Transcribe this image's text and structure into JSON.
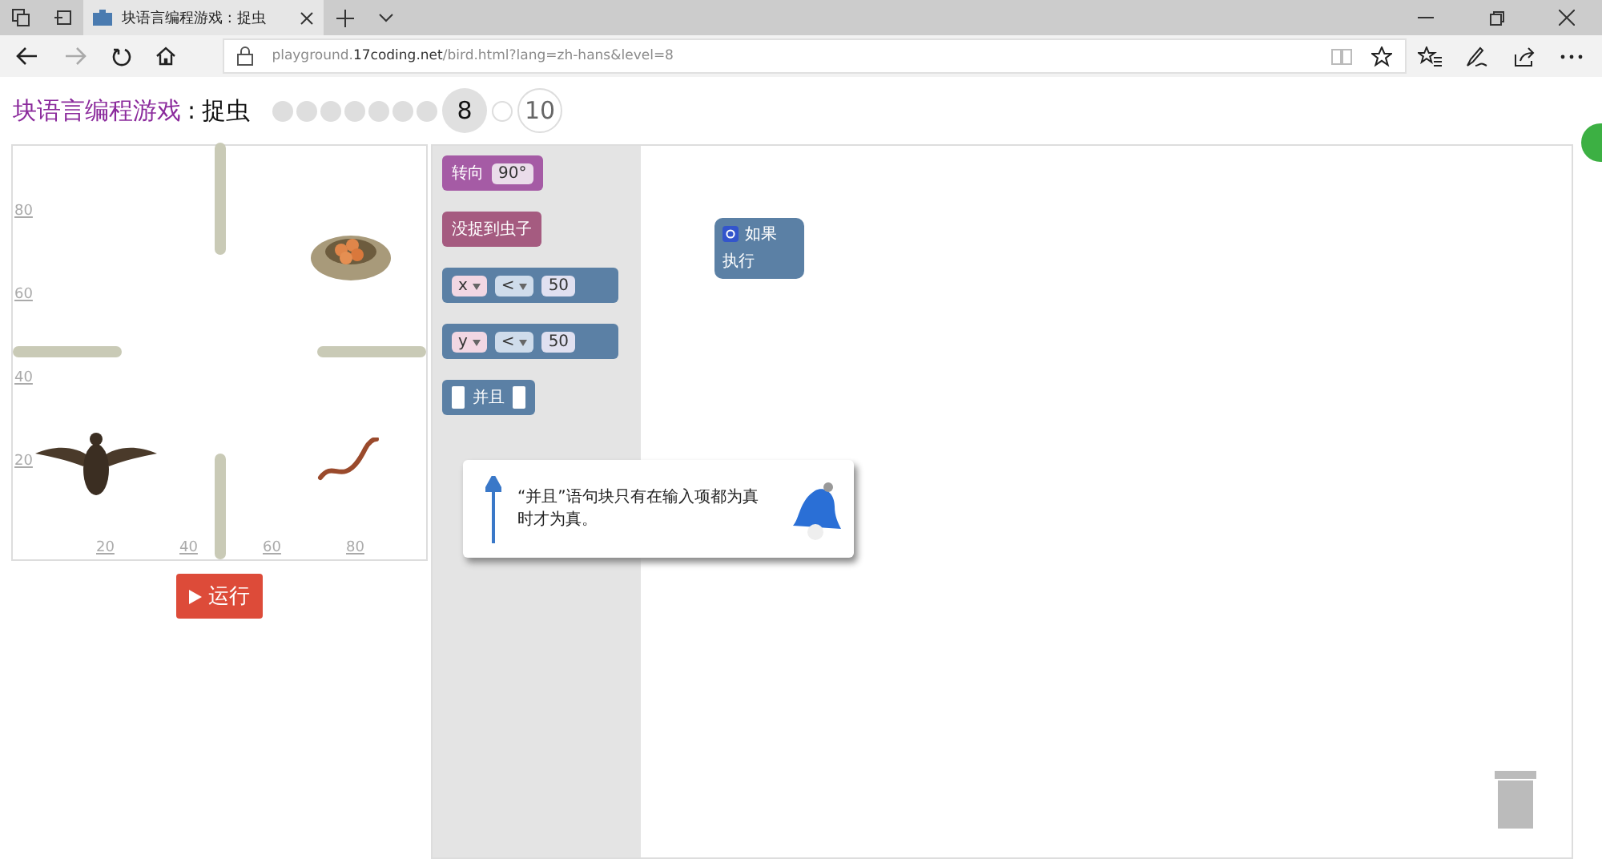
{
  "browser": {
    "tab_title": "块语言编程游戏 : 捉虫",
    "url": "playground.**17coding.net**/bird.html?lang=zh-hans&level=8"
  },
  "header": {
    "title": "块语言编程游戏",
    "separator": ":",
    "subtitle": "捉虫"
  },
  "levels": [
    {
      "kind": "dot",
      "done": true,
      "selected": false
    },
    {
      "kind": "dot",
      "done": true,
      "selected": false
    },
    {
      "kind": "dot",
      "done": true,
      "selected": false
    },
    {
      "kind": "dot",
      "done": true,
      "selected": false
    },
    {
      "kind": "dot",
      "done": true,
      "selected": false
    },
    {
      "kind": "dot",
      "done": true,
      "selected": false
    },
    {
      "kind": "dot",
      "done": true,
      "selected": false
    },
    {
      "kind": "number",
      "label": "8",
      "selected": true
    },
    {
      "kind": "dot",
      "done": false,
      "selected": false
    },
    {
      "kind": "number",
      "label": "10",
      "selected": false
    }
  ],
  "map": {
    "y_ticks": [
      "80",
      "60",
      "40",
      "20"
    ],
    "x_ticks": [
      "20",
      "40",
      "60",
      "80"
    ]
  },
  "run_button": "运行",
  "toolbox": [
    {
      "kind": "turn",
      "text": "转向",
      "value": "90°"
    },
    {
      "kind": "condition",
      "text": "没捉到虫子"
    },
    {
      "kind": "compare",
      "variable": "x",
      "operator": "<",
      "value": "50"
    },
    {
      "kind": "compare",
      "variable": "y",
      "operator": "<",
      "value": "50"
    },
    {
      "kind": "and",
      "text": "并且"
    }
  ],
  "workspace": {
    "if_block": {
      "label": "如果",
      "body": "执行"
    }
  },
  "tooltip": "“并且”语句块只有在输入项都为真时才为真。"
}
